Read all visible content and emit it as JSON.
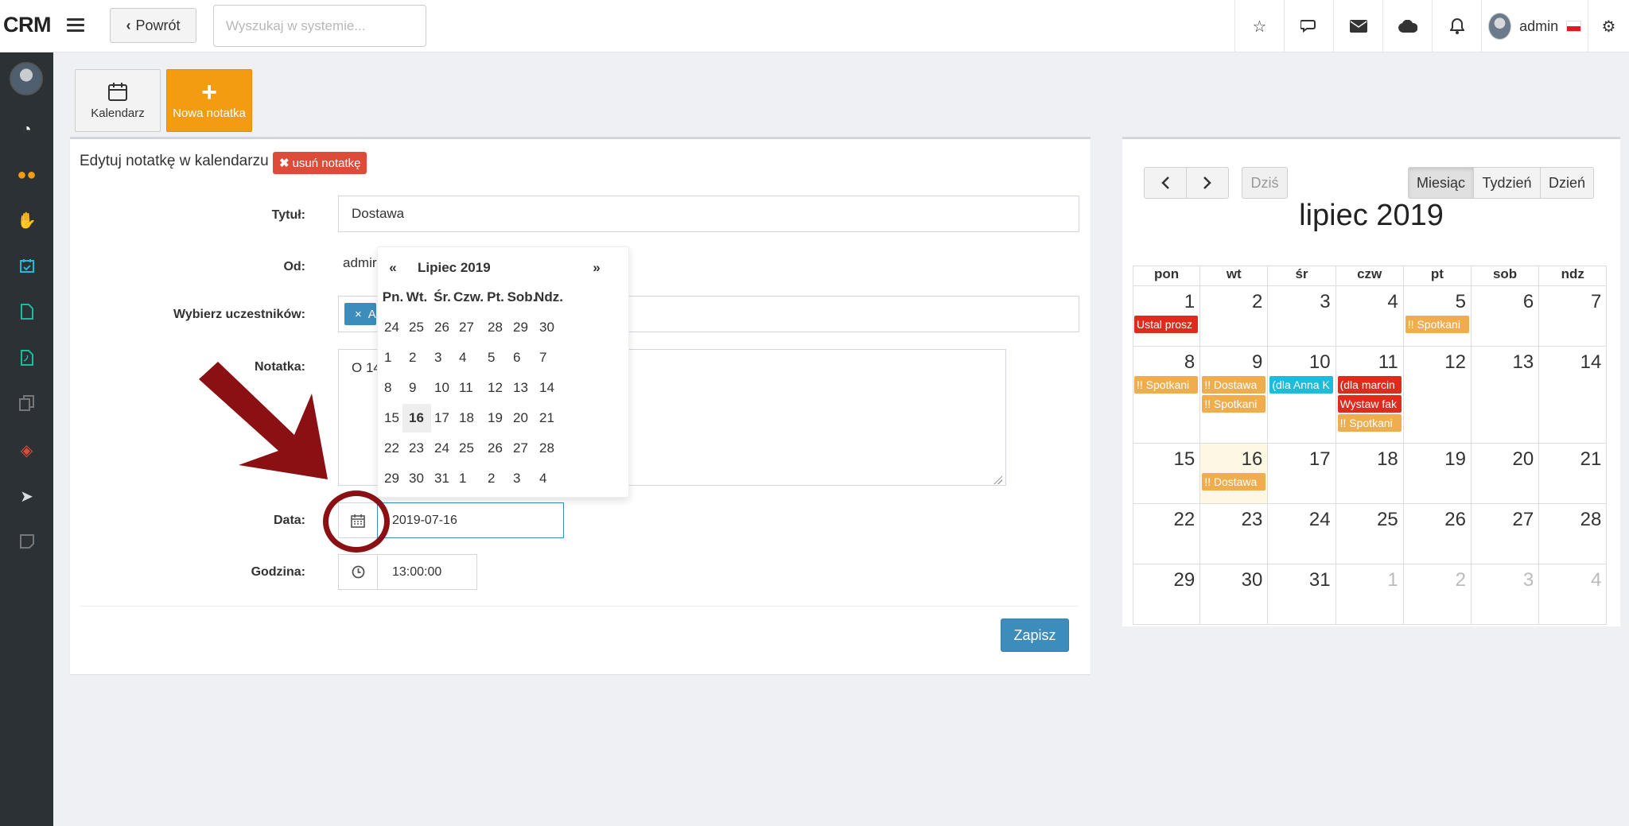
{
  "app": {
    "brand": "CRM"
  },
  "topbar": {
    "back_label": "Powrót",
    "search_placeholder": "Wyszukaj w systemie...",
    "user_name": "admin"
  },
  "toolbar": {
    "calendar_label": "Kalendarz",
    "new_note_label": "Nowa notatka"
  },
  "form": {
    "title": "Edytuj notatkę w kalendarzu",
    "delete_label": "usuń notatkę",
    "labels": {
      "title": "Tytuł:",
      "from": "Od:",
      "participants": "Wybierz uczestników:",
      "note": "Notatka:",
      "date": "Data:",
      "time": "Godzina:"
    },
    "title_value": "Dostawa",
    "from_value": "admir",
    "participant_tag": "A",
    "note_value": "O 14",
    "date_value": "2019-07-16",
    "time_value": "13:00:00",
    "save_label": "Zapisz"
  },
  "datepicker": {
    "prev": "«",
    "next": "»",
    "month_label": "Lipiec 2019",
    "weekdays": [
      "Pn.",
      "Wt.",
      "Śr.",
      "Czw.",
      "Pt.",
      "Sob.",
      "Ndz."
    ],
    "weeks": [
      [
        "24",
        "25",
        "26",
        "27",
        "28",
        "29",
        "30"
      ],
      [
        "1",
        "2",
        "3",
        "4",
        "5",
        "6",
        "7"
      ],
      [
        "8",
        "9",
        "10",
        "11",
        "12",
        "13",
        "14"
      ],
      [
        "15",
        "16",
        "17",
        "18",
        "19",
        "20",
        "21"
      ],
      [
        "22",
        "23",
        "24",
        "25",
        "26",
        "27",
        "28"
      ],
      [
        "29",
        "30",
        "31",
        "1",
        "2",
        "3",
        "4"
      ]
    ],
    "selected": "16"
  },
  "calendar": {
    "today_label": "Dziś",
    "views": [
      "Miesiąc",
      "Tydzień",
      "Dzień"
    ],
    "active_view": "Miesiąc",
    "title": "lipiec 2019",
    "weekdays": [
      "pon",
      "wt",
      "śr",
      "czw",
      "pt",
      "sob",
      "ndz"
    ],
    "weeks": [
      [
        "1",
        "2",
        "3",
        "4",
        "5",
        "6",
        "7"
      ],
      [
        "8",
        "9",
        "10",
        "11",
        "12",
        "13",
        "14"
      ],
      [
        "15",
        "16",
        "17",
        "18",
        "19",
        "20",
        "21"
      ],
      [
        "22",
        "23",
        "24",
        "25",
        "26",
        "27",
        "28"
      ],
      [
        "29",
        "30",
        "31",
        "1",
        "2",
        "3",
        "4"
      ]
    ],
    "events": [
      {
        "week": 0,
        "day": 0,
        "slot": 0,
        "text": "Ustal prosz",
        "color": "#dd2c1c"
      },
      {
        "week": 0,
        "day": 4,
        "slot": 0,
        "text": "!! Spotkani",
        "color": "#f0ad4e"
      },
      {
        "week": 1,
        "day": 0,
        "slot": 0,
        "text": "!! Spotkani",
        "color": "#f0ad4e"
      },
      {
        "week": 1,
        "day": 1,
        "slot": 0,
        "text": "!! Dostawa",
        "color": "#f0ad4e"
      },
      {
        "week": 1,
        "day": 1,
        "slot": 1,
        "text": "!! Spotkani",
        "color": "#f0ad4e"
      },
      {
        "week": 1,
        "day": 2,
        "slot": 0,
        "text": "(dla Anna K",
        "color": "#1ebcdc"
      },
      {
        "week": 1,
        "day": 3,
        "slot": 0,
        "text": "(dla marcin",
        "color": "#dd2c1c"
      },
      {
        "week": 1,
        "day": 3,
        "slot": 1,
        "text": "Wystaw fak",
        "color": "#dd2c1c"
      },
      {
        "week": 1,
        "day": 3,
        "slot": 2,
        "text": "!! Spotkani",
        "color": "#f0ad4e"
      },
      {
        "week": 2,
        "day": 1,
        "slot": 0,
        "text": "!! Dostawa",
        "color": "#f0ad4e"
      }
    ]
  },
  "colors": {
    "primary": "#3c8dbc",
    "orange": "#f39c12",
    "danger": "#dd4b39",
    "sidebar": "#2b3135",
    "annotation": "#8b1014"
  },
  "sidebar_icons": [
    "dashboard-icon",
    "users-icon",
    "handshake-icon",
    "calendar-check-icon",
    "document-icon",
    "pdf-icon",
    "copy-icon",
    "ticket-icon",
    "paper-plane-icon",
    "note-icon"
  ]
}
